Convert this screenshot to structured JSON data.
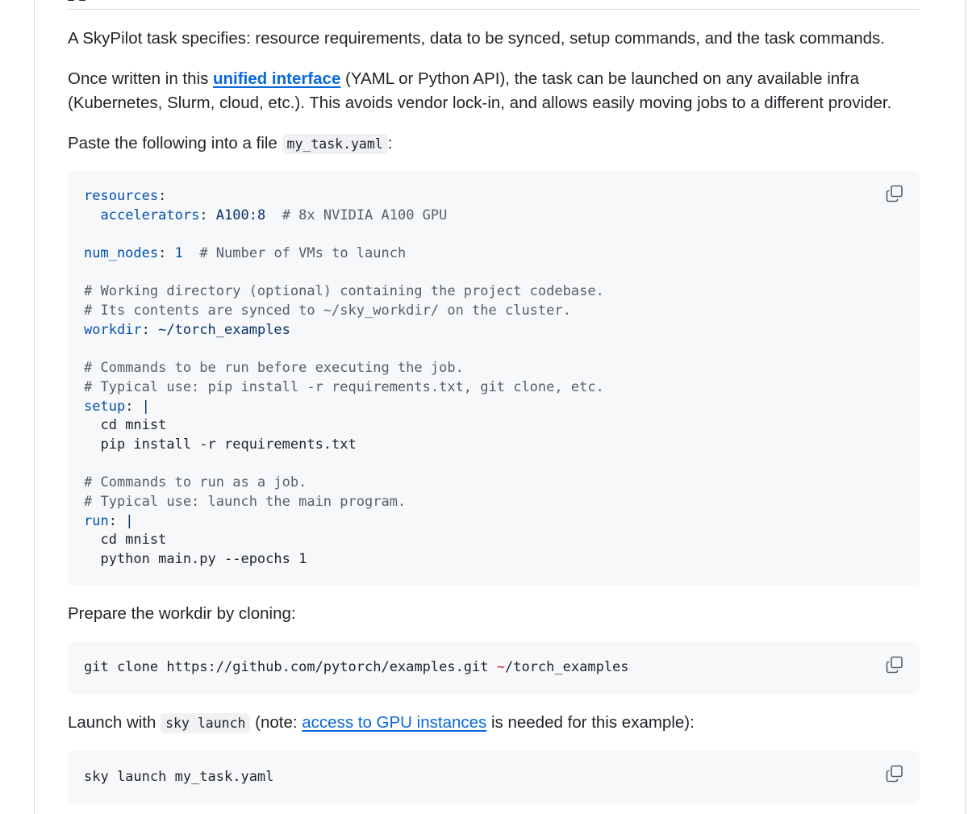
{
  "intro": {
    "p1": "A SkyPilot task specifies: resource requirements, data to be synced, setup commands, and the task commands.",
    "p2_before": "Once written in this ",
    "p2_link": "unified interface",
    "p2_after": " (YAML or Python API), the task can be launched on any available infra (Kubernetes, Slurm, cloud, etc.). This avoids vendor lock-in, and allows easily moving jobs to a different provider.",
    "p3_before": "Paste the following into a file ",
    "p3_code": "my_task.yaml",
    "p3_after": ":"
  },
  "yaml_block": {
    "lines": [
      {
        "key": "resources",
        "sep": ":",
        "value": "",
        "comment": ""
      },
      {
        "indent": "  ",
        "key": "accelerators",
        "sep": ": ",
        "value": "A100:8",
        "comment": "  # 8x NVIDIA A100 GPU"
      },
      {
        "blank": true
      },
      {
        "key": "num_nodes",
        "sep": ": ",
        "num": "1",
        "comment": "  # Number of VMs to launch"
      },
      {
        "blank": true
      },
      {
        "comment_only": "# Working directory (optional) containing the project codebase."
      },
      {
        "comment_only": "# Its contents are synced to ~/sky_workdir/ on the cluster."
      },
      {
        "key": "workdir",
        "sep": ": ",
        "value": "~/torch_examples"
      },
      {
        "blank": true
      },
      {
        "comment_only": "# Commands to be run before executing the job."
      },
      {
        "comment_only": "# Typical use: pip install -r requirements.txt, git clone, etc."
      },
      {
        "key": "setup",
        "sep": ": ",
        "value": "|"
      },
      {
        "plain": "  cd mnist"
      },
      {
        "plain": "  pip install -r requirements.txt"
      },
      {
        "blank": true
      },
      {
        "comment_only": "# Commands to run as a job."
      },
      {
        "comment_only": "# Typical use: launch the main program."
      },
      {
        "key": "run",
        "sep": ": ",
        "value": "|"
      },
      {
        "plain": "  cd mnist"
      },
      {
        "plain": "  python main.py --epochs 1"
      }
    ]
  },
  "prepare": {
    "text": "Prepare the workdir by cloning:",
    "cmd_before": "git clone https://github.com/pytorch/examples.git ",
    "cmd_tilde": "~",
    "cmd_after": "/torch_examples"
  },
  "launch": {
    "text_before": "Launch with ",
    "code": "sky launch",
    "text_mid": " (note: ",
    "link": "access to GPU instances",
    "text_after": " is needed for this example):",
    "cmd": "sky launch my_task.yaml"
  },
  "colors": {
    "link": "#0969da",
    "yaml_key": "#0550ae",
    "yaml_value": "#0a3069",
    "comment": "#57606a",
    "tilde": "#cf222e",
    "code_bg": "#f6f8fa"
  },
  "icons": {
    "copy": "copy-icon"
  }
}
